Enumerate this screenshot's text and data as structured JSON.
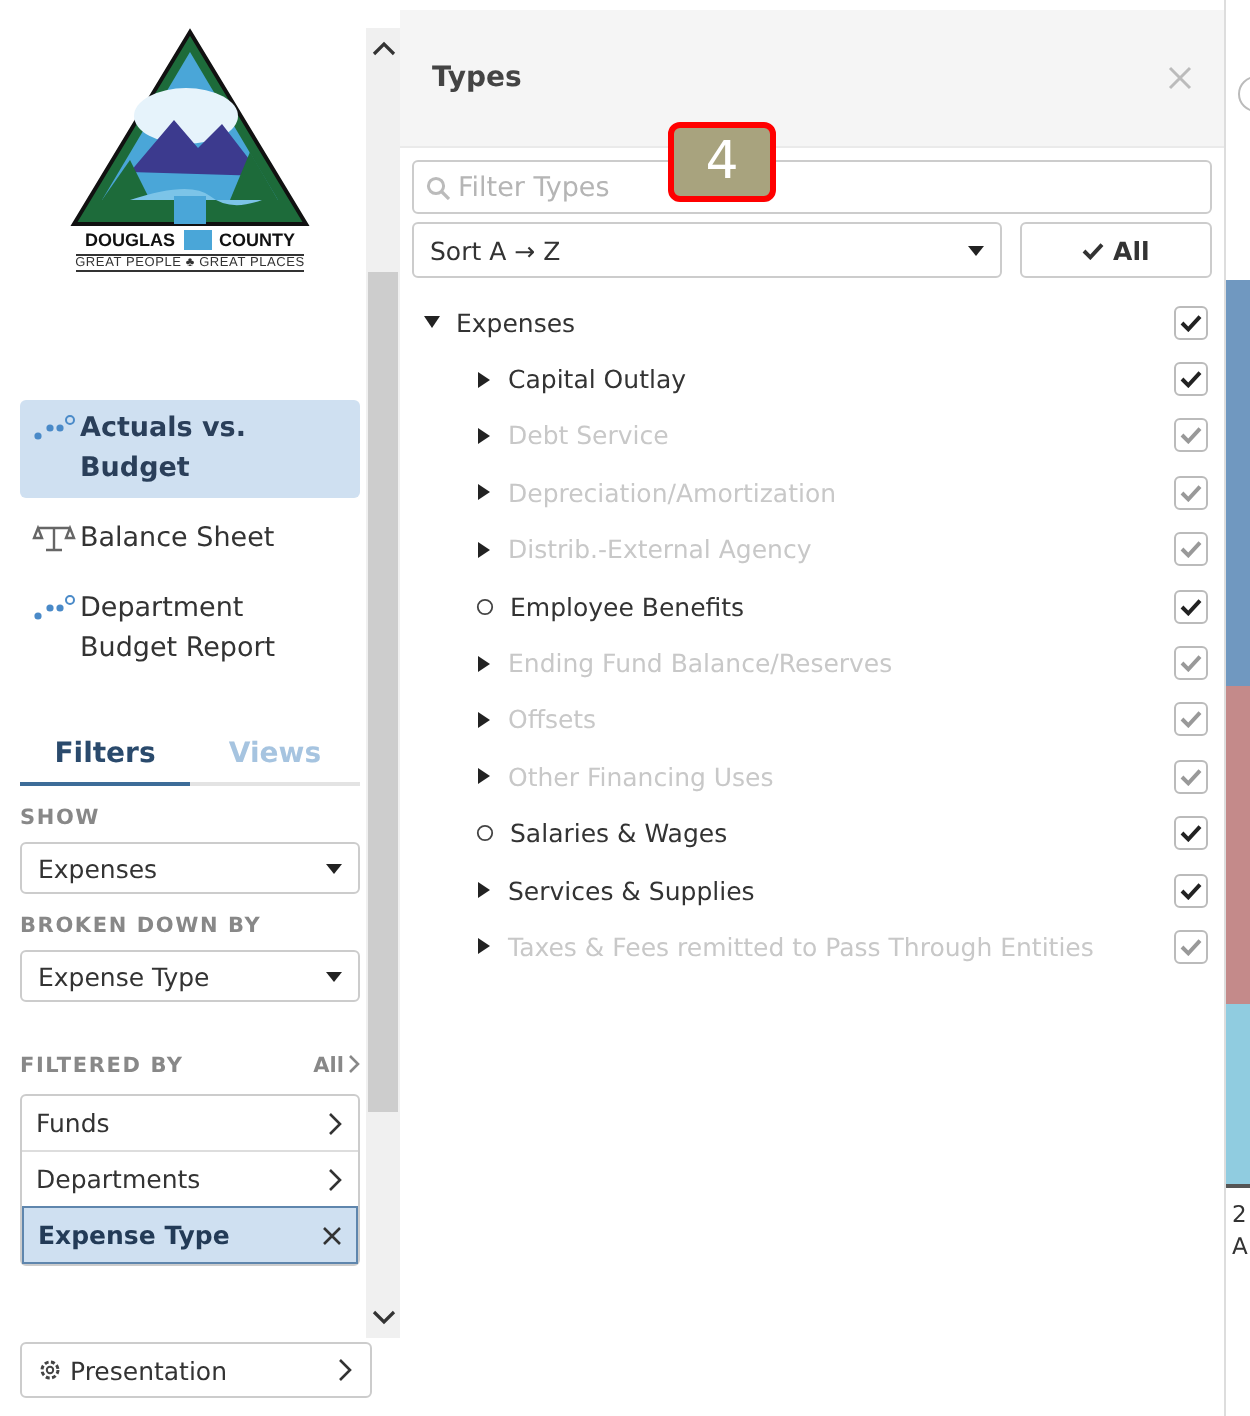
{
  "logo": {
    "word_left": "DOUGLAS",
    "word_right": "COUNTY",
    "tagline": "GREAT PEOPLE ♣ GREAT PLACES"
  },
  "nav": [
    {
      "label": "Actuals vs. Budget",
      "kind": "dots",
      "selected": true
    },
    {
      "label": "Balance Sheet",
      "kind": "scale",
      "selected": false
    },
    {
      "label": "Department Budget Report",
      "kind": "dots",
      "selected": false
    }
  ],
  "tabs": [
    {
      "label": "Filters",
      "selected": true
    },
    {
      "label": "Views",
      "selected": false
    }
  ],
  "show": {
    "label": "SHOW",
    "value": "Expenses"
  },
  "broken_down_by": {
    "label": "BROKEN DOWN BY",
    "value": "Expense Type"
  },
  "filtered_by": {
    "label": "FILTERED BY",
    "all_link": "All",
    "items": [
      {
        "label": "Funds",
        "selected": false
      },
      {
        "label": "Departments",
        "selected": false
      },
      {
        "label": "Expense Type",
        "selected": true
      }
    ]
  },
  "presentation": {
    "label": "Presentation"
  },
  "panel": {
    "title": "Types",
    "search": {
      "placeholder": "Filter Types"
    },
    "sort": "Sort A → Z",
    "all_button": "All",
    "tree": [
      {
        "label": "Expenses",
        "kind": "branch",
        "expanded": true,
        "checked": true,
        "disabled": false,
        "children": [
          {
            "label": "Capital Outlay",
            "kind": "branch",
            "expanded": false,
            "checked": true,
            "disabled": false
          },
          {
            "label": "Debt Service",
            "kind": "branch",
            "expanded": false,
            "checked": true,
            "disabled": true
          },
          {
            "label": "Depreciation/Amortization",
            "kind": "branch",
            "expanded": false,
            "checked": true,
            "disabled": true
          },
          {
            "label": "Distrib.-External Agency",
            "kind": "branch",
            "expanded": false,
            "checked": true,
            "disabled": true
          },
          {
            "label": "Employee Benefits",
            "kind": "leaf",
            "checked": true,
            "disabled": false
          },
          {
            "label": "Ending Fund Balance/Reserves",
            "kind": "branch",
            "expanded": false,
            "checked": true,
            "disabled": true
          },
          {
            "label": "Offsets",
            "kind": "branch",
            "expanded": false,
            "checked": true,
            "disabled": true
          },
          {
            "label": "Other Financing Uses",
            "kind": "branch",
            "expanded": false,
            "checked": true,
            "disabled": true
          },
          {
            "label": "Salaries & Wages",
            "kind": "leaf",
            "checked": true,
            "disabled": false
          },
          {
            "label": "Services & Supplies",
            "kind": "branch",
            "expanded": false,
            "checked": true,
            "disabled": false
          },
          {
            "label": "Taxes & Fees remitted to Pass Through Entities",
            "kind": "branch",
            "expanded": false,
            "checked": true,
            "disabled": true
          }
        ]
      }
    ]
  },
  "callout": {
    "label": "4"
  },
  "chart_edge": {
    "segments": [
      {
        "color": "#7098c0"
      },
      {
        "color": "#c48a8a"
      },
      {
        "color": "#90cce0"
      }
    ],
    "axis_label_lines": [
      "2",
      "A"
    ]
  }
}
